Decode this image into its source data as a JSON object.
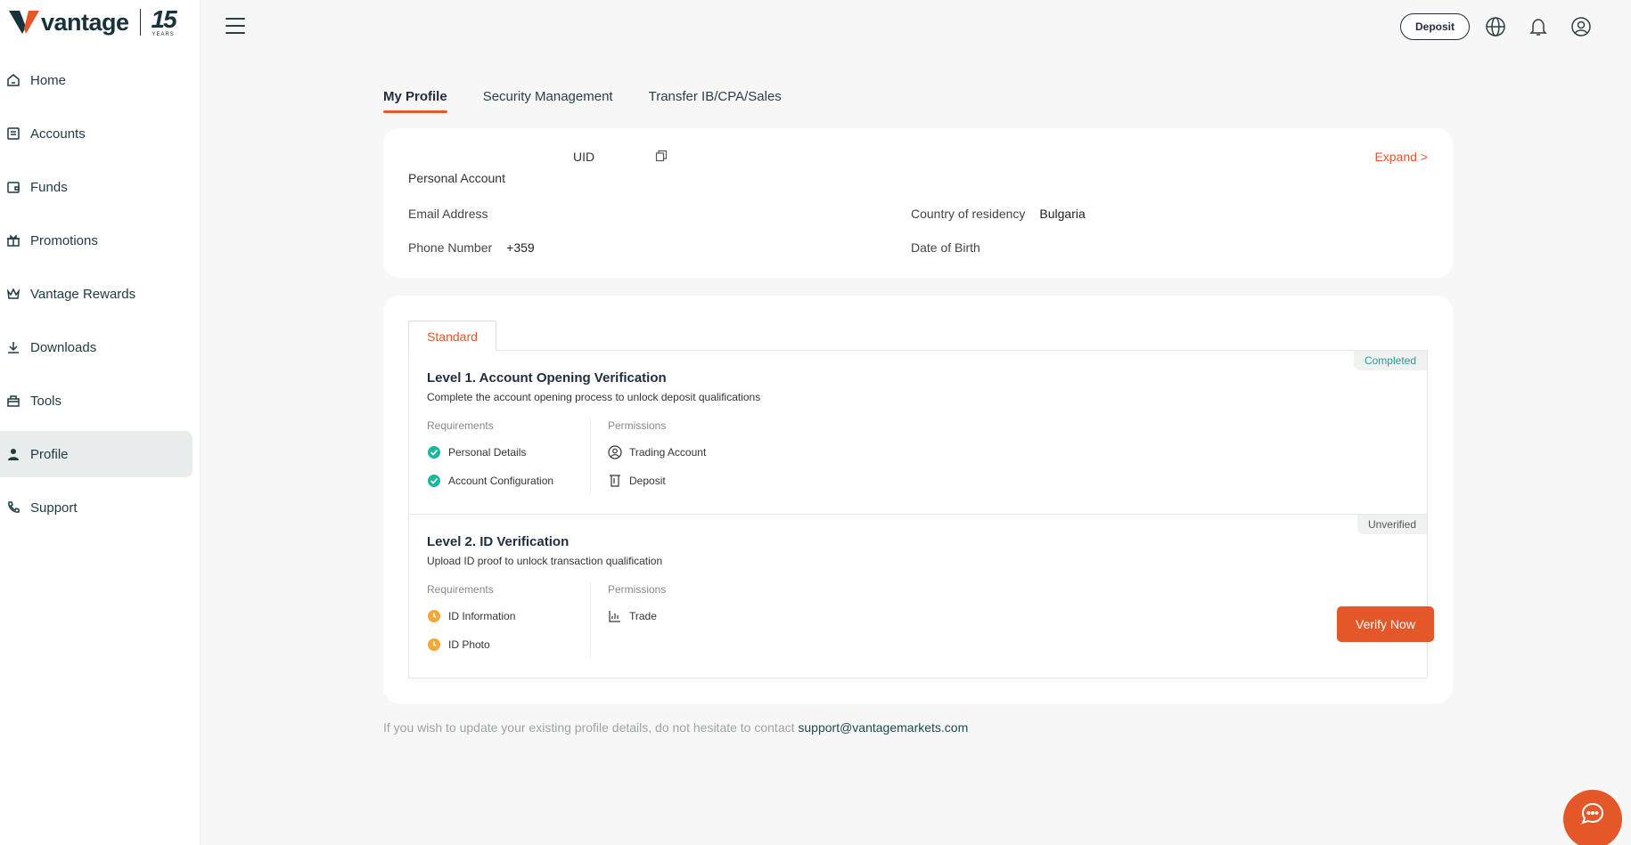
{
  "brand": {
    "name": "vantage",
    "anniversary_number": "15",
    "anniversary_word": "YEARS"
  },
  "sidebar": {
    "items": [
      {
        "label": "Home",
        "icon": "home-icon"
      },
      {
        "label": "Accounts",
        "icon": "accounts-icon"
      },
      {
        "label": "Funds",
        "icon": "wallet-icon"
      },
      {
        "label": "Promotions",
        "icon": "gift-icon"
      },
      {
        "label": "Vantage Rewards",
        "icon": "crown-icon"
      },
      {
        "label": "Downloads",
        "icon": "download-icon"
      },
      {
        "label": "Tools",
        "icon": "toolbox-icon"
      },
      {
        "label": "Profile",
        "icon": "user-icon",
        "active": true
      },
      {
        "label": "Support",
        "icon": "phone-icon"
      }
    ]
  },
  "header": {
    "deposit_label": "Deposit",
    "icons": [
      "globe-icon",
      "bell-icon",
      "account-circle-icon"
    ]
  },
  "tabs": {
    "items": [
      {
        "label": "My Profile",
        "active": true
      },
      {
        "label": "Security Management"
      },
      {
        "label": "Transfer IB/CPA/Sales"
      }
    ]
  },
  "profile": {
    "uid_label": "UID",
    "account_type": "Personal Account",
    "expand_label": "Expand >",
    "email_label": "Email Address",
    "email_value": "",
    "phone_label": "Phone Number",
    "phone_value": "+359",
    "country_label": "Country of residency",
    "country_value": "Bulgaria",
    "dob_label": "Date of Birth",
    "dob_value": ""
  },
  "verification": {
    "tab_label": "Standard",
    "requirements_label": "Requirements",
    "permissions_label": "Permissions",
    "level1": {
      "title": "Level 1. Account Opening Verification",
      "description": "Complete the account opening process to unlock deposit qualifications",
      "status": "Completed",
      "requirements": [
        "Personal Details",
        "Account Configuration"
      ],
      "permissions": [
        "Trading Account",
        "Deposit"
      ]
    },
    "level2": {
      "title": "Level 2. ID Verification",
      "description": "Upload ID proof to unlock transaction qualification",
      "status": "Unverified",
      "requirements": [
        "ID Information",
        "ID Photo"
      ],
      "permissions": [
        "Trade"
      ],
      "action_label": "Verify Now"
    }
  },
  "footer": {
    "note": "If you wish to update your existing profile details, do not hesitate to contact",
    "email": "support@vantagemarkets.com"
  },
  "colors": {
    "accent": "#e35728",
    "success": "#1aa38c",
    "pending": "#f2a93b",
    "text_dark": "#1f2d3d"
  }
}
